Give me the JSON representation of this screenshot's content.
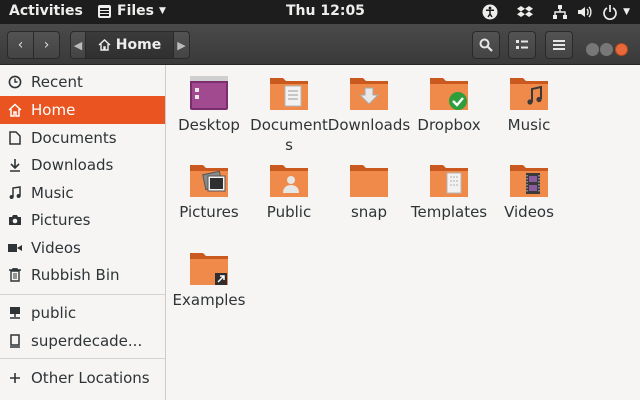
{
  "topbar": {
    "activities": "Activities",
    "app_menu": "Files",
    "clock": "Thu 12:05",
    "tray_icons": [
      "accessibility-icon",
      "dropbox-icon",
      "network-icon",
      "volume-icon",
      "power-icon"
    ]
  },
  "header": {
    "path_home": "Home"
  },
  "sidebar": {
    "items": [
      {
        "label": "Recent",
        "icon": "clock-icon"
      },
      {
        "label": "Home",
        "icon": "home-icon",
        "active": true
      },
      {
        "label": "Documents",
        "icon": "document-icon"
      },
      {
        "label": "Downloads",
        "icon": "download-icon"
      },
      {
        "label": "Music",
        "icon": "music-icon"
      },
      {
        "label": "Pictures",
        "icon": "camera-icon"
      },
      {
        "label": "Videos",
        "icon": "video-icon"
      },
      {
        "label": "Rubbish Bin",
        "icon": "trash-icon"
      }
    ],
    "network": [
      {
        "label": "public",
        "icon": "network-drive-icon"
      },
      {
        "label": "superdecade...",
        "icon": "usb-drive-icon"
      }
    ],
    "other": {
      "label": "Other Locations",
      "icon": "plus-icon"
    }
  },
  "files": [
    {
      "name": "Desktop",
      "icon": "desktop-folder-icon"
    },
    {
      "name": "Documents",
      "icon": "documents-folder-icon"
    },
    {
      "name": "Downloads",
      "icon": "downloads-folder-icon"
    },
    {
      "name": "Dropbox",
      "icon": "dropbox-folder-icon"
    },
    {
      "name": "Music",
      "icon": "music-folder-icon"
    },
    {
      "name": "Pictures",
      "icon": "pictures-folder-icon"
    },
    {
      "name": "Public",
      "icon": "public-folder-icon"
    },
    {
      "name": "snap",
      "icon": "folder-icon"
    },
    {
      "name": "Templates",
      "icon": "templates-folder-icon"
    },
    {
      "name": "Videos",
      "icon": "videos-folder-icon"
    },
    {
      "name": "Examples",
      "icon": "examples-link-folder-icon"
    }
  ],
  "colors": {
    "accent": "#e95420",
    "folder_orange": "#e8834e",
    "topbar": "#1d1d1d",
    "headerbar": "#404040"
  }
}
